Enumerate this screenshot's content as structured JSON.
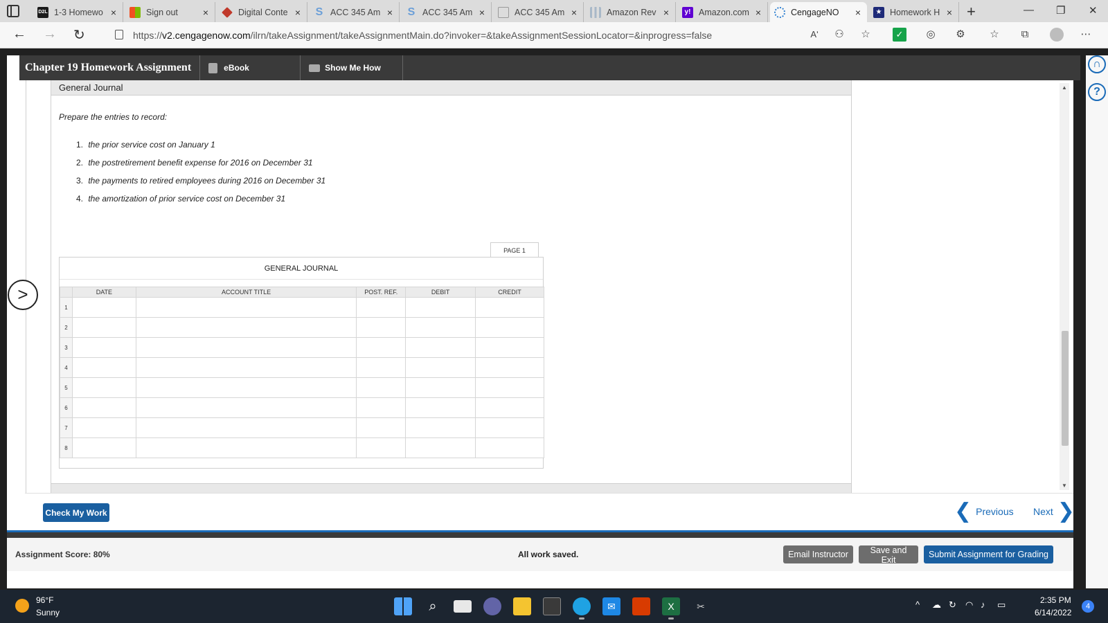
{
  "browser": {
    "tabs": [
      {
        "label": "1-3 Homewo",
        "icon": "d2l-icon",
        "icon_text": "D2L",
        "icon_color": "#1b1b1b"
      },
      {
        "label": "Sign out",
        "icon": "microsoft-icon",
        "icon_text": "",
        "icon_color": "#7fba00"
      },
      {
        "label": "Digital Conte",
        "icon": "layers-icon",
        "icon_text": "",
        "icon_color": "#c0392b"
      },
      {
        "label": "ACC 345 Am",
        "icon": "s-icon",
        "icon_text": "S",
        "icon_color": "#6b9fd8"
      },
      {
        "label": "ACC 345 Am",
        "icon": "s-icon",
        "icon_text": "S",
        "icon_color": "#6b9fd8"
      },
      {
        "label": "ACC 345 Am",
        "icon": "document-icon",
        "icon_text": "",
        "icon_color": "#bbbbbb"
      },
      {
        "label": "Amazon Rev",
        "icon": "chart-icon",
        "icon_text": "",
        "icon_color": "#a8b8c8"
      },
      {
        "label": "Amazon.com",
        "icon": "yahoo-icon",
        "icon_text": "y!",
        "icon_color": "#6001d2"
      },
      {
        "label": "CengageNO",
        "icon": "cengage-icon",
        "icon_text": "",
        "icon_color": "#2f80d1",
        "active": true
      },
      {
        "label": "Homework H",
        "icon": "star-icon",
        "icon_text": "★",
        "icon_color": "#1e2a78"
      }
    ],
    "close_glyph": "×",
    "new_tab_glyph": "+",
    "url_prefix": "https://",
    "url_host": "v2.cengagenow.com",
    "url_path": "/ilrn/takeAssignment/takeAssignmentMain.do?invoker=&takeAssignmentSessionLocator=&inprogress=false",
    "read_aloud": "Aʹ",
    "window_controls": {
      "minimize": "—",
      "restore": "❐",
      "close": "✕"
    },
    "back_glyph": "←",
    "forward_glyph": "→",
    "refresh_glyph": "↻"
  },
  "app": {
    "title": "Chapter 19 Homework Assignment",
    "ebook_label": "eBook",
    "show_me_label": "Show Me How",
    "section_title": "General Journal",
    "instructions": "Prepare the entries to record:",
    "entries": [
      {
        "num": "1.",
        "text": "the prior service cost on January 1"
      },
      {
        "num": "2.",
        "text": "the postretirement benefit expense for 2016 on December 31"
      },
      {
        "num": "3.",
        "text": "the payments to retired employees during 2016 on December 31"
      },
      {
        "num": "4.",
        "text": "the amortization of prior service cost on December 31"
      }
    ],
    "page_label": "PAGE 1",
    "journal_title": "GENERAL JOURNAL",
    "columns": [
      "DATE",
      "ACCOUNT TITLE",
      "POST. REF.",
      "DEBIT",
      "CREDIT"
    ],
    "rows": [
      "1",
      "2",
      "3",
      "4",
      "5",
      "6",
      "7",
      "8"
    ],
    "expander_glyph": ">",
    "check_label": "Check My Work",
    "previous_label": "Previous",
    "next_label": "Next",
    "prev_chevron": "❮",
    "next_chevron": "❯",
    "score_label": "Assignment Score: 80%",
    "saved_label": "All work saved.",
    "email_label": "Email Instructor",
    "save_exit_label": "Save and Exit",
    "submit_label": "Submit Assignment for Grading",
    "help_glyph": "?"
  },
  "taskbar": {
    "temp": "96°F",
    "condition": "Sunny",
    "time": "2:35 PM",
    "date": "6/14/2022",
    "notifications": "4"
  },
  "colors": {
    "accent_blue": "#1a5fa0",
    "header_dark": "#3a3a3a",
    "link_blue": "#1a6bb8"
  }
}
